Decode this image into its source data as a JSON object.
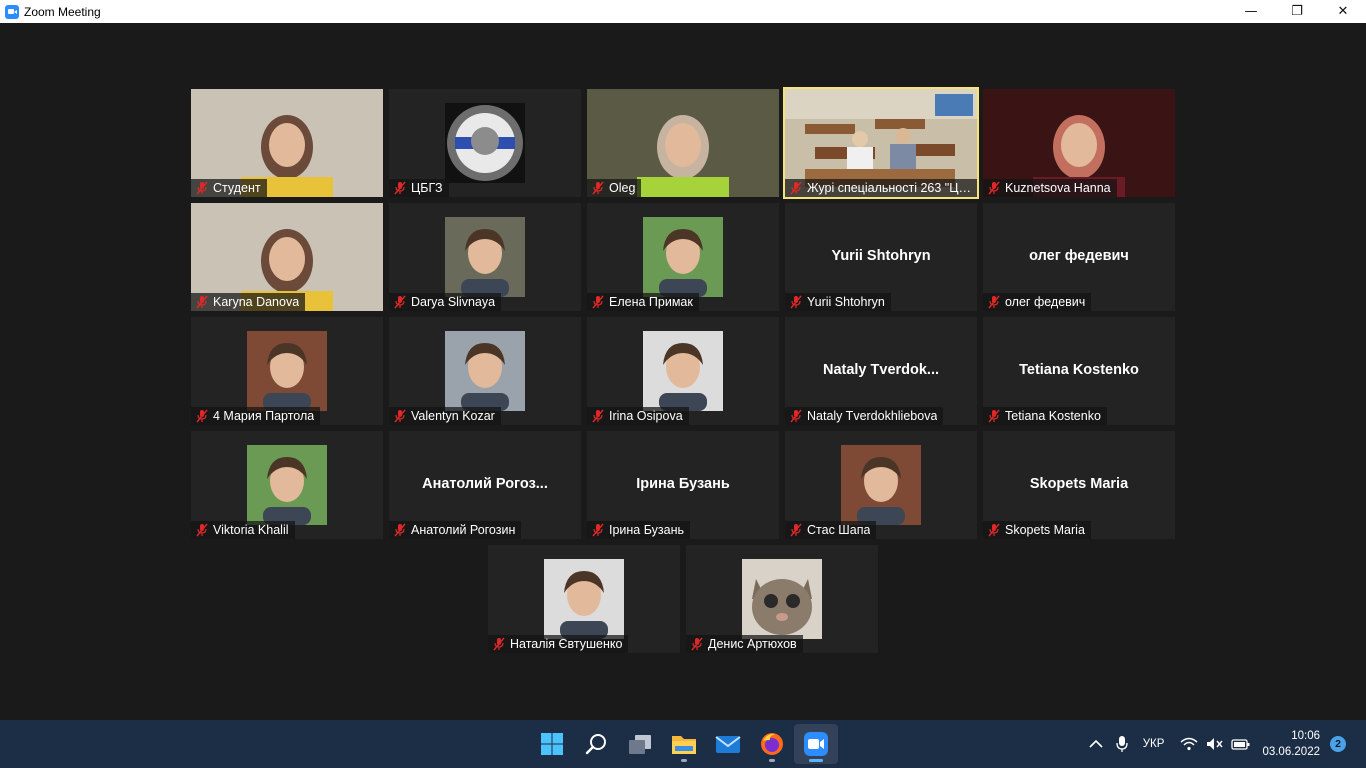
{
  "window": {
    "title": "Zoom Meeting",
    "minimize": "—",
    "restore": "❐",
    "close": "✕"
  },
  "participants": [
    {
      "name": "Студент",
      "muted": true,
      "kind": "video",
      "icon": "person-video"
    },
    {
      "name": "ЦБГЗ",
      "muted": true,
      "kind": "avatar",
      "icon": "emblem-medal-avatar"
    },
    {
      "name": "Oleg",
      "muted": true,
      "kind": "video",
      "icon": "person-video"
    },
    {
      "name": "Журі спеціальності 263 \"Циві...",
      "muted": true,
      "kind": "video",
      "icon": "classroom-video",
      "active_speaker": true
    },
    {
      "name": "Kuznetsova Hanna",
      "muted": true,
      "kind": "video",
      "icon": "person-video"
    },
    {
      "name": "Karyna Danova",
      "muted": true,
      "kind": "video",
      "icon": "person-video"
    },
    {
      "name": "Darya Slivnaya",
      "muted": true,
      "kind": "avatar",
      "icon": "profile-photo-avatar"
    },
    {
      "name": "Елена Примак",
      "muted": true,
      "kind": "avatar",
      "icon": "profile-photo-avatar"
    },
    {
      "name": "Yurii Shtohryn",
      "muted": true,
      "kind": "text",
      "display": "Yurii Shtohryn"
    },
    {
      "name": "олег федевич",
      "muted": true,
      "kind": "text",
      "display": "олег федевич"
    },
    {
      "name": "4 Мария Партола",
      "muted": true,
      "kind": "avatar",
      "icon": "profile-photo-avatar"
    },
    {
      "name": "Valentyn Kozar",
      "muted": true,
      "kind": "avatar",
      "icon": "profile-photo-avatar"
    },
    {
      "name": "Irina Osipova",
      "muted": true,
      "kind": "avatar",
      "icon": "profile-photo-avatar"
    },
    {
      "name": "Nataly Tverdokhliebova",
      "muted": true,
      "kind": "text",
      "display": "Nataly  Tverdok..."
    },
    {
      "name": "Tetiana Kostenko",
      "muted": true,
      "kind": "text",
      "display": "Tetiana Kostenko"
    },
    {
      "name": "Viktoria Khalil",
      "muted": true,
      "kind": "avatar",
      "icon": "profile-photo-avatar"
    },
    {
      "name": "Анатолий Рогозин",
      "muted": true,
      "kind": "text",
      "display": "Анатолий  Рогоз..."
    },
    {
      "name": "Ірина Бузань",
      "muted": true,
      "kind": "text",
      "display": "Ірина Бузань"
    },
    {
      "name": "Стас Шапа",
      "muted": true,
      "kind": "avatar",
      "icon": "profile-photo-avatar"
    },
    {
      "name": "Skopets Maria",
      "muted": true,
      "kind": "text",
      "display": "Skopets Maria"
    },
    {
      "name": "Наталія Євтушенко",
      "muted": true,
      "kind": "avatar",
      "icon": "profile-photo-avatar"
    },
    {
      "name": "Денис Артюхов",
      "muted": true,
      "kind": "avatar",
      "icon": "cat-photo-avatar"
    }
  ],
  "taskbar": {
    "apps": [
      {
        "name": "start-icon",
        "running": false
      },
      {
        "name": "search-icon",
        "running": false
      },
      {
        "name": "task-view-icon",
        "running": false
      },
      {
        "name": "file-explorer-icon",
        "running": true
      },
      {
        "name": "mail-icon",
        "running": false
      },
      {
        "name": "firefox-icon",
        "running": true
      },
      {
        "name": "zoom-icon",
        "running": true,
        "active": true
      }
    ],
    "language": "УКР",
    "time": "10:06",
    "date": "03.06.2022",
    "notifications": "2"
  },
  "colors": {
    "background": "#1a1a1a",
    "tile": "#232323",
    "active_speaker_border": "#f3e379",
    "muted_red": "#e02828",
    "taskbar": "#1c2d46"
  }
}
